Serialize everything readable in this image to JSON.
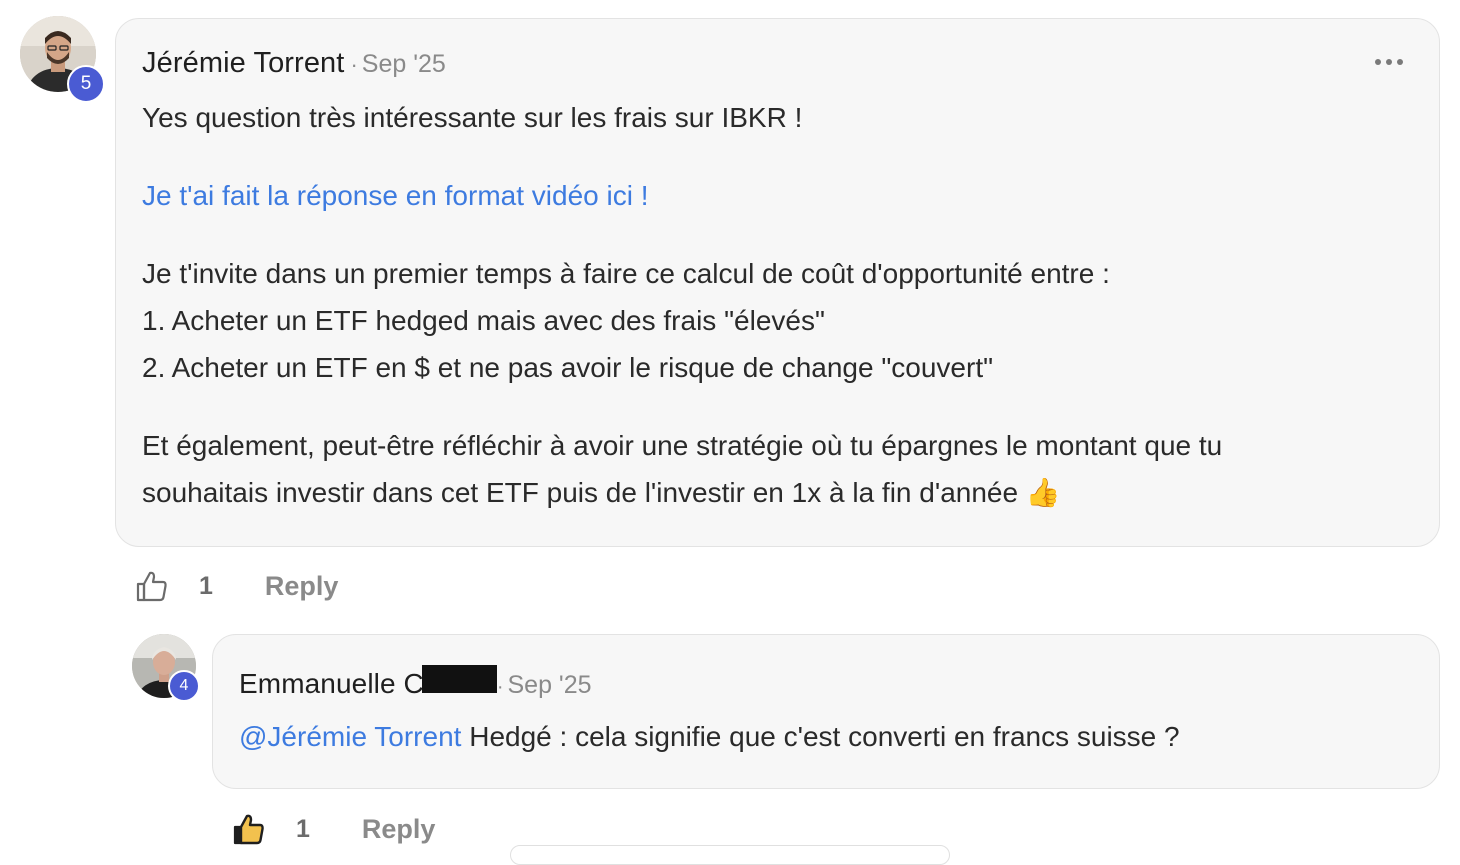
{
  "comment": {
    "author": "Jérémie Torrent",
    "separator": "·",
    "date": "Sep '25",
    "level": "5",
    "more_icon": "more-horizontal-icon",
    "body": {
      "line1": "Yes question très intéressante sur les frais sur IBKR !",
      "video_link": "Je t'ai fait la réponse en format vidéo ici !",
      "para2_line1": "Je t'invite dans un premier temps à faire ce calcul de coût d'opportunité entre :",
      "para2_line2": "1. Acheter un ETF hedged mais avec des frais \"élevés\"",
      "para2_line3": "2. Acheter un ETF en $ et ne pas avoir le risque de change \"couvert\"",
      "para3_line1": "Et également, peut-être réfléchir à avoir une stratégie où tu épargnes le montant que tu",
      "para3_line2": "souhaitais investir dans cet ETF puis de l'investir en 1x à la fin d'année",
      "emoji": "👍"
    },
    "likes": "1",
    "liked": false,
    "reply_label": "Reply"
  },
  "reply": {
    "author": "Emmanuelle C",
    "separator": "·",
    "date": "Sep '25",
    "level": "4",
    "mention": "@Jérémie Torrent",
    "text": " Hedgé : cela signifie que c'est converti en francs suisse ?",
    "likes": "1",
    "liked": true,
    "reply_label": "Reply"
  },
  "colors": {
    "link": "#3d7be0",
    "level_badge": "#4a5bd3",
    "bubble_bg": "#f7f7f7"
  }
}
